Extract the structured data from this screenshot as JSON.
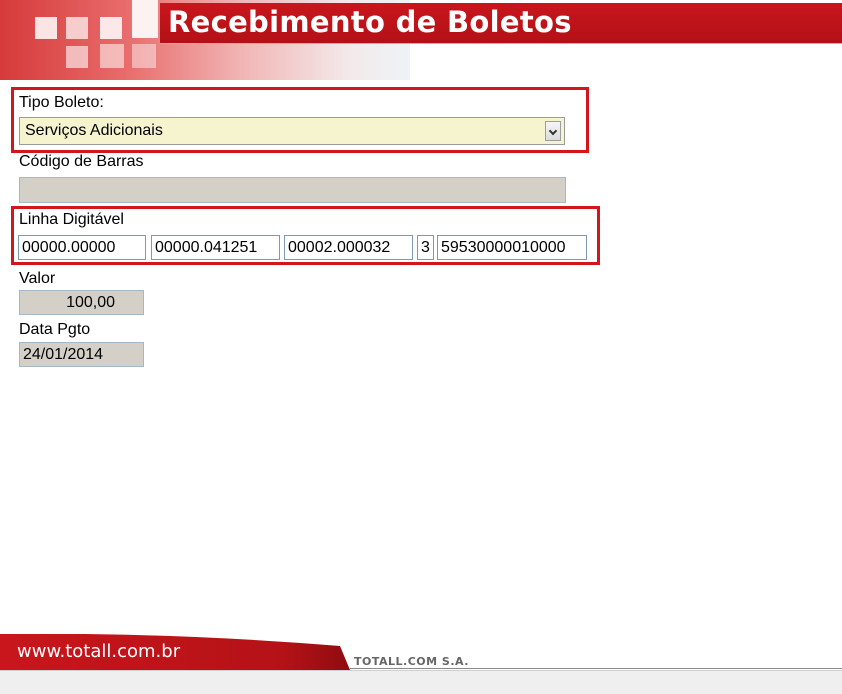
{
  "header": {
    "title": "Recebimento de Boletos"
  },
  "form": {
    "tipo_boleto_label": "Tipo Boleto:",
    "tipo_boleto_value": "Serviços Adicionais",
    "codigo_barras_label": "Código de Barras",
    "codigo_barras_value": "",
    "linha_label": "Linha Digitável",
    "linha_fields": [
      "00000.00000",
      "00000.041251",
      "00002.000032",
      "3",
      "59530000010000"
    ],
    "valor_label": "Valor",
    "valor_value": "100,00",
    "data_label": "Data Pgto",
    "data_value": "24/01/2014"
  },
  "footer": {
    "website": "www.totall.com.br",
    "company": "TOTALL.COM S.A."
  },
  "colors": {
    "brand_red": "#c8161c",
    "highlight_red": "#d4151b",
    "select_bg": "#f6f3cf",
    "readonly_bg": "#d4d0c8"
  }
}
